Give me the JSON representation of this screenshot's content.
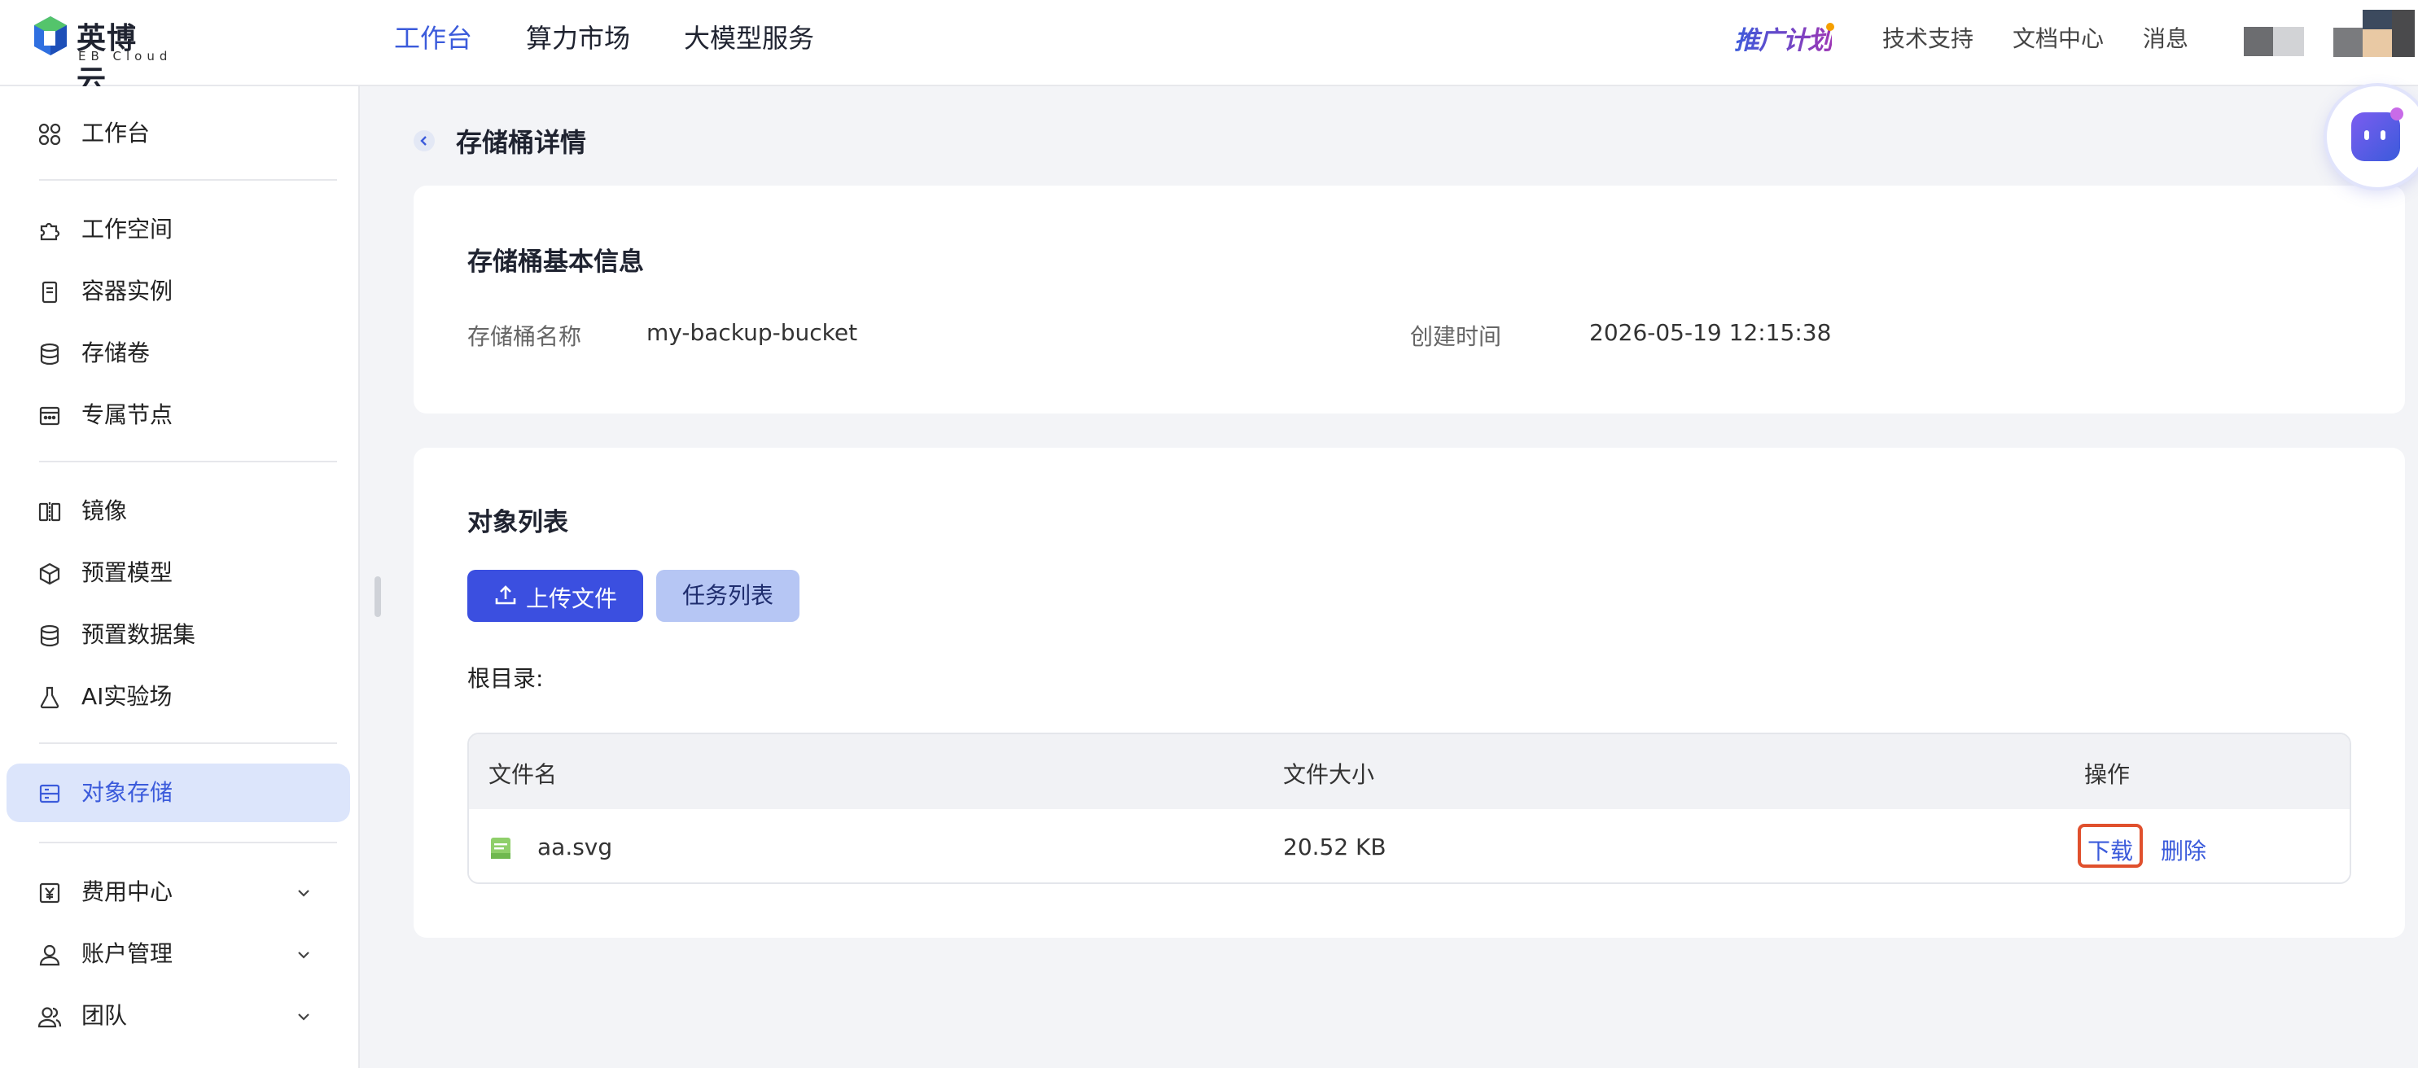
{
  "header": {
    "logo_cn": "英博云",
    "logo_en": "EB Cloud",
    "nav": [
      "工作台",
      "算力市场",
      "大模型服务"
    ],
    "promo": "推广计划",
    "links": [
      "技术支持",
      "文档中心",
      "消息"
    ]
  },
  "sidebar": {
    "items": [
      {
        "label": "工作台",
        "icon": "grid-icon"
      },
      {
        "label": "工作空间",
        "icon": "puzzle-icon"
      },
      {
        "label": "容器实例",
        "icon": "container-icon"
      },
      {
        "label": "存储卷",
        "icon": "database-icon"
      },
      {
        "label": "专属节点",
        "icon": "node-icon"
      },
      {
        "label": "镜像",
        "icon": "mirror-icon"
      },
      {
        "label": "预置模型",
        "icon": "cube-icon"
      },
      {
        "label": "预置数据集",
        "icon": "database-icon"
      },
      {
        "label": "AI实验场",
        "icon": "flask-icon"
      },
      {
        "label": "对象存储",
        "icon": "storage-icon",
        "active": true
      },
      {
        "label": "费用中心",
        "icon": "yen-icon"
      },
      {
        "label": "账户管理",
        "icon": "user-icon"
      },
      {
        "label": "团队",
        "icon": "team-icon"
      }
    ]
  },
  "page": {
    "title": "存储桶详情"
  },
  "basic_info": {
    "title": "存储桶基本信息",
    "name_label": "存储桶名称",
    "name_value": "my-backup-bucket",
    "created_label": "创建时间",
    "created_value": "2026-05-19 12:15:38"
  },
  "objects": {
    "title": "对象列表",
    "upload_button": "上传文件",
    "tasks_button": "任务列表",
    "path_label": "根目录:",
    "columns": [
      "文件名",
      "文件大小",
      "操作"
    ],
    "rows": [
      {
        "name": "aa.svg",
        "size": "20.52 KB",
        "actions": [
          "下载",
          "删除"
        ]
      }
    ]
  },
  "colors": {
    "accent": "#3b5bdb",
    "primary_button": "#3b4fe0",
    "highlight": "#e0502d"
  }
}
